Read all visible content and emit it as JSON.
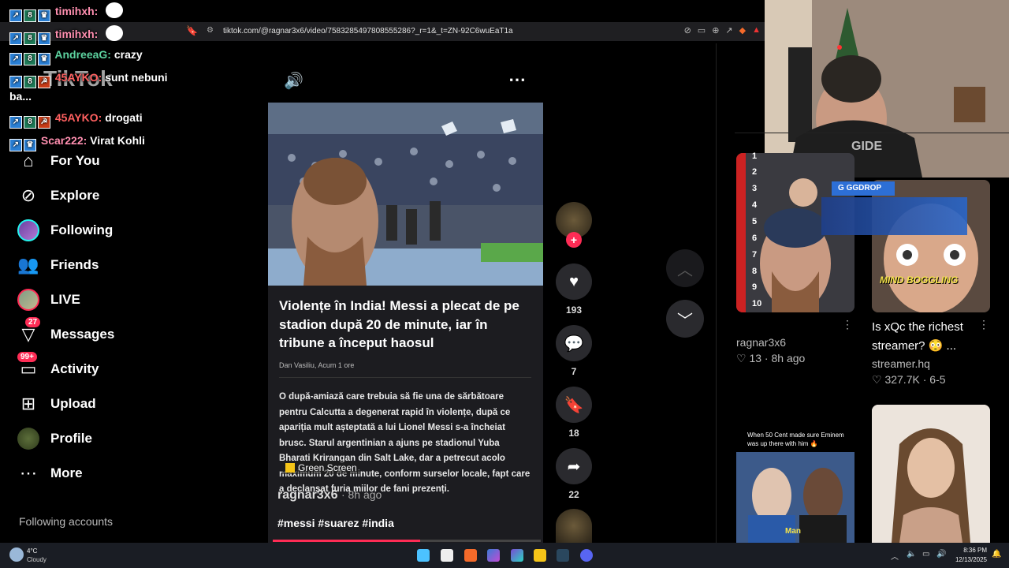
{
  "browser": {
    "url": "tiktok.com/@ragnar3x6/video/7583285497808555286?_r=1&_t=ZN-92C6wuEaT1a"
  },
  "chat": [
    {
      "user": "timihxh:",
      "msg": "",
      "color": "#ff8fb0"
    },
    {
      "user": "timihxh:",
      "msg": "",
      "color": "#ff8fb0"
    },
    {
      "user": "AndreeaG:",
      "msg": "crazy",
      "color": "#5dd3a0"
    },
    {
      "user": "45AYKO:",
      "msg": "sunt nebuni",
      "cont": "ba...",
      "color": "#ff6060"
    },
    {
      "user": "45AYKO:",
      "msg": "drogati",
      "color": "#ff6060"
    },
    {
      "user": "Scar222:",
      "msg": "Virat Kohli",
      "color": "#ff8fb0"
    }
  ],
  "tiktok_logo": "TikTok",
  "nav": {
    "for_you": "For You",
    "explore": "Explore",
    "following": "Following",
    "friends": "Friends",
    "live": "LIVE",
    "messages": "Messages",
    "messages_badge": "27",
    "activity": "Activity",
    "activity_badge": "99+",
    "upload": "Upload",
    "profile": "Profile",
    "more": "More",
    "following_accounts": "Following accounts"
  },
  "video": {
    "article_title": "Violențe în India! Messi a plecat de pe stadion după 20 de minute, iar în tribune a început haosul",
    "article_author": "Dan Vasiliu, Acum 1 ore",
    "article_body": "O după-amiază care trebuia să fie una de sărbătoare pentru Calcutta a degenerat rapid în violențe, după ce apariția mult așteptată a lui Lionel Messi s-a încheiat brusc. Starul argentinian a ajuns pe stadionul Yuba Bharati Krirangan din Salt Lake, dar a petrecut acolo maximum 20 de minute, conform surselor locale, fapt care a declanșat furia miilor de fani prezenți.",
    "green_screen": "Green Screen",
    "author": "ragnar3x6",
    "time": "· 8h ago",
    "hashtags": "#messi #suarez #india"
  },
  "actions": {
    "likes": "193",
    "comments": "7",
    "saves": "18",
    "shares": "22"
  },
  "recommendations": [
    {
      "author": "ragnar3x6",
      "likes": "13",
      "time": "8h ago"
    },
    {
      "title_line1": "Is xQc the richest",
      "title_line2": "streamer? 😳 ...",
      "author": "streamer.hq",
      "likes": "327.7K",
      "time": "6-5"
    }
  ],
  "overlay": {
    "ggdrop": "GGDROP",
    "numbers": [
      "1",
      "2",
      "3",
      "4",
      "5",
      "6",
      "7",
      "8",
      "9",
      "10"
    ],
    "mind_boggling": "MIND BOGGLING",
    "fifty_cent": "When 50 Cent made sure Eminem was up there with him 🔥",
    "man": "Man"
  },
  "taskbar": {
    "weather_temp": "4°C",
    "weather_desc": "Cloudy",
    "time": "8:36 PM",
    "date": "12/13/2025"
  }
}
